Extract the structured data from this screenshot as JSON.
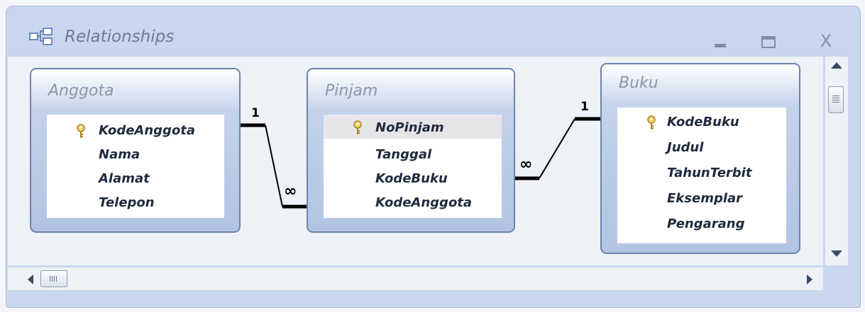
{
  "window": {
    "title": "Relationships",
    "minimize_label": "_",
    "maximize_label": "",
    "close_label": "X"
  },
  "tables": {
    "anggota": {
      "name": "Anggota",
      "fields": [
        "KodeAnggota",
        "Nama",
        "Alamat",
        "Telepon"
      ],
      "primary_key": "KodeAnggota"
    },
    "pinjam": {
      "name": "Pinjam",
      "fields": [
        "NoPinjam",
        "Tanggal",
        "KodeBuku",
        "KodeAnggota"
      ],
      "primary_key": "NoPinjam",
      "selected_field": "NoPinjam"
    },
    "buku": {
      "name": "Buku",
      "fields": [
        "KodeBuku",
        "Judul",
        "TahunTerbit",
        "Eksemplar",
        "Pengarang"
      ],
      "primary_key": "KodeBuku"
    }
  },
  "relationships": [
    {
      "from_table": "Anggota",
      "from_field": "KodeAnggota",
      "from_cardinality": "1",
      "to_table": "Pinjam",
      "to_field": "KodeAnggota",
      "to_cardinality": "∞"
    },
    {
      "from_table": "Buku",
      "from_field": "KodeBuku",
      "from_cardinality": "1",
      "to_table": "Pinjam",
      "to_field": "KodeBuku",
      "to_cardinality": "∞"
    }
  ],
  "icons": {
    "title": "relationships-icon",
    "key": "key-icon"
  },
  "colors": {
    "window_frame": "#c9d7ee",
    "table_border": "#6a84ae",
    "key": "#c9a83a",
    "selection": "#e6e6e9"
  }
}
